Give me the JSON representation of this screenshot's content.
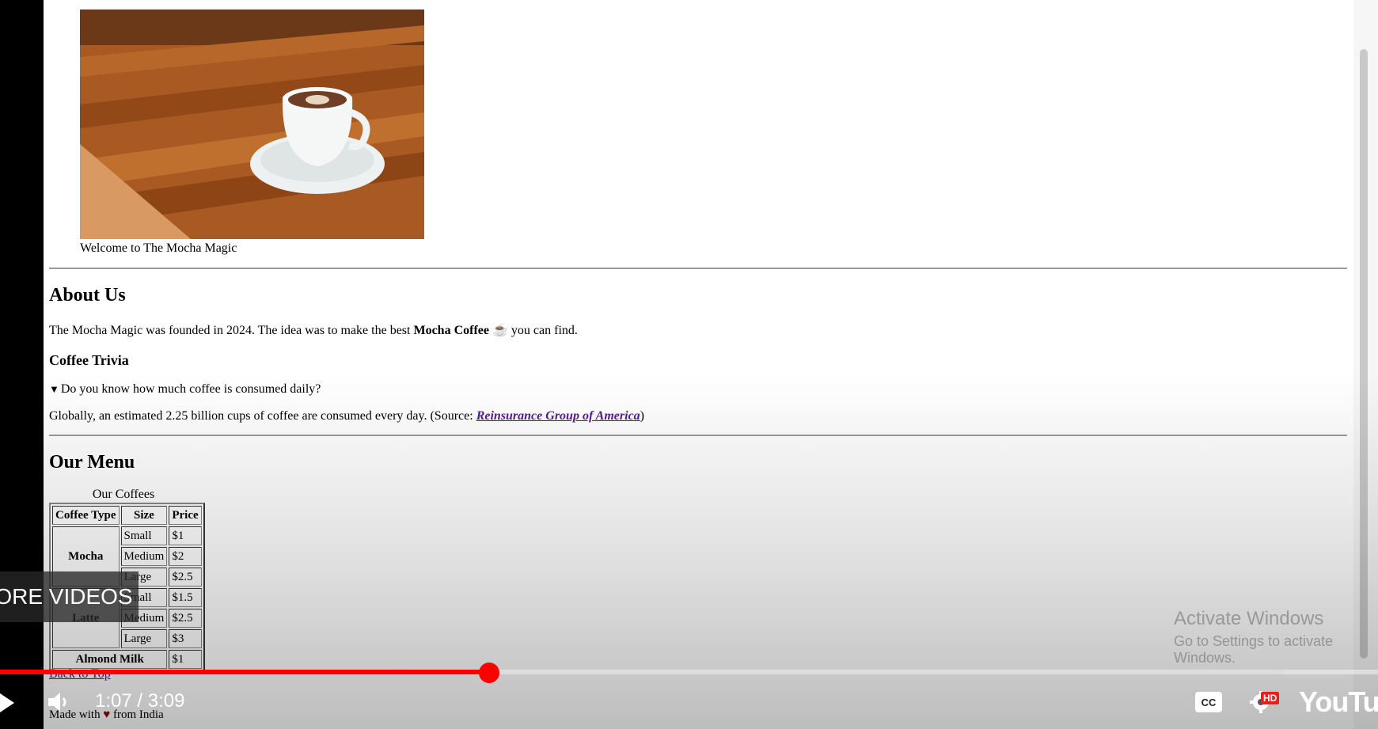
{
  "page": {
    "caption": "Welcome to The Mocha Magic",
    "about": {
      "title": "About Us",
      "text_before": "The Mocha Magic was founded in 2024. The idea was to make the best ",
      "bold": "Mocha Coffee",
      "emoji": "☕",
      "text_after": " you can find."
    },
    "trivia": {
      "title": "Coffee Trivia",
      "summary": "Do you know how much coffee is consumed daily?",
      "text_before": "Globally, an estimated 2.25 billion cups of coffee are consumed every day. (Source: ",
      "link": "Reinsurance Group of America",
      "text_after": ")"
    },
    "menu": {
      "title": "Our Menu",
      "caption": "Our Coffees",
      "headers": [
        "Coffee Type",
        "Size",
        "Price"
      ],
      "mocha": {
        "name": "Mocha",
        "rows": [
          [
            "Small",
            "$1"
          ],
          [
            "Medium",
            "$2"
          ],
          [
            "Large",
            "$2.5"
          ]
        ]
      },
      "latte": {
        "name": "Latte",
        "rows": [
          [
            "Small",
            "$1.5"
          ],
          [
            "Medium",
            "$2.5"
          ],
          [
            "Large",
            "$3"
          ]
        ]
      },
      "almond": {
        "name": "Almond Milk",
        "price": "$1"
      }
    },
    "back_to_top": "Back to Top",
    "made_with_before": "Made with ",
    "heart": "♥",
    "made_with_after": " from India"
  },
  "windows": {
    "line1": "Activate Windows",
    "line2": "Go to Settings to activate Windows."
  },
  "player": {
    "more_videos": "MORE VIDEOS",
    "time": "1:07 / 3:09",
    "progress_fraction": 0.355,
    "hd_badge": "HD",
    "logo": "YouTube",
    "accent": "#ff0000"
  }
}
